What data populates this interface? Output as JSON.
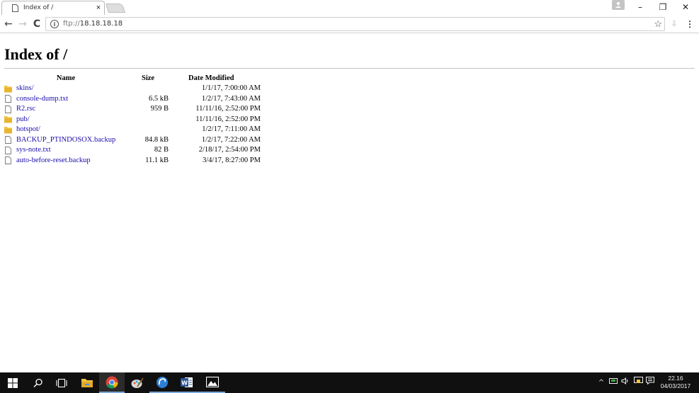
{
  "browser": {
    "tab_title": "Index of /",
    "tab_close_glyph": "×",
    "window_controls": {
      "minimize": "–",
      "restore": "❐",
      "close": "✕"
    },
    "nav": {
      "back": "←",
      "forward": "→",
      "reload": "C"
    },
    "url_scheme": "ftp://",
    "url_host": "18.18.18.18",
    "icons": [
      "document-icon",
      "info-icon",
      "star-icon",
      "extension-icon",
      "menu-icon",
      "profile-icon"
    ]
  },
  "page": {
    "title": "Index of /",
    "columns": {
      "name": "Name",
      "size": "Size",
      "date": "Date Modified"
    },
    "entries": [
      {
        "name": "skins/",
        "size": "",
        "date": "1/1/17, 7:00:00 AM",
        "type": "folder"
      },
      {
        "name": "console-dump.txt",
        "size": "6.5 kB",
        "date": "1/2/17, 7:43:00 AM",
        "type": "file"
      },
      {
        "name": "R2.rsc",
        "size": "959 B",
        "date": "11/11/16, 2:52:00 PM",
        "type": "file"
      },
      {
        "name": "pub/",
        "size": "",
        "date": "11/11/16, 2:52:00 PM",
        "type": "folder"
      },
      {
        "name": "hotspot/",
        "size": "",
        "date": "1/2/17, 7:11:00 AM",
        "type": "folder"
      },
      {
        "name": "BACKUP_PTINDOSOX.backup",
        "size": "84.8 kB",
        "date": "1/2/17, 7:22:00 AM",
        "type": "file"
      },
      {
        "name": "sys-note.txt",
        "size": "82 B",
        "date": "2/18/17, 2:54:00 PM",
        "type": "file"
      },
      {
        "name": "auto-before-reset.backup",
        "size": "11.1 kB",
        "date": "3/4/17, 8:27:00 PM",
        "type": "file"
      }
    ]
  },
  "taskbar": {
    "apps": [
      "windows-start",
      "search",
      "task-view",
      "file-explorer",
      "chrome",
      "paint",
      "app-swirl",
      "word",
      "photos"
    ],
    "active_app": "chrome",
    "tray_chevron": "^",
    "clock": {
      "time": "22.16",
      "date": "04/03/2017"
    },
    "colors": {
      "taskbar": "#101010",
      "accent": "#7aa7d6",
      "folder": "#f4c33b",
      "link": "#1a0dab"
    }
  }
}
